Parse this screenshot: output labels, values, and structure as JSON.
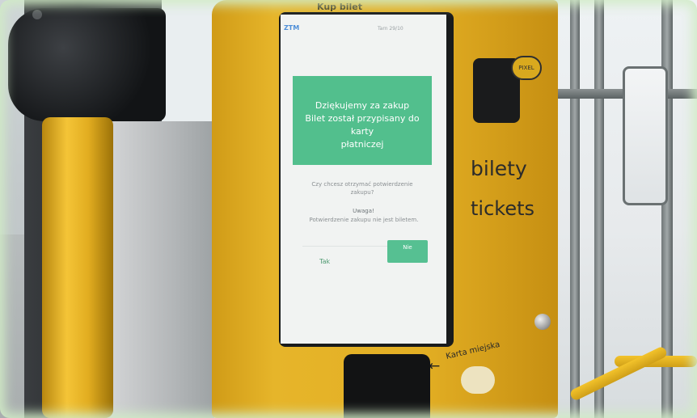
{
  "machine": {
    "top_title": "Kup bilet",
    "brand": "PIXEL",
    "sign_line1": "bilety",
    "sign_line2": "tickets",
    "card_label": "Karta miejska"
  },
  "screen": {
    "header_logo": "ZTM",
    "header_right": "Tarn 29/10",
    "message_line1": "Dziękujemy za zakup",
    "message_line2": "Bilet został przypisany do karty",
    "message_line3": "płatniczej",
    "question": "Czy chcesz otrzymać potwierdzenie zakupu?",
    "warning_title": "Uwaga!",
    "warning_text": "Potwierdzenie zakupu nie jest biletem.",
    "button_no": "Tak",
    "button_yes": "Nie"
  },
  "colors": {
    "machine_yellow": "#e3af24",
    "screen_green": "#52bf8d",
    "frame_dark": "#2b2e31"
  },
  "icons": {
    "arrow": "arrow-left-icon",
    "knob": "pixel-knob-icon",
    "nfc": "nfc-card-icon"
  }
}
